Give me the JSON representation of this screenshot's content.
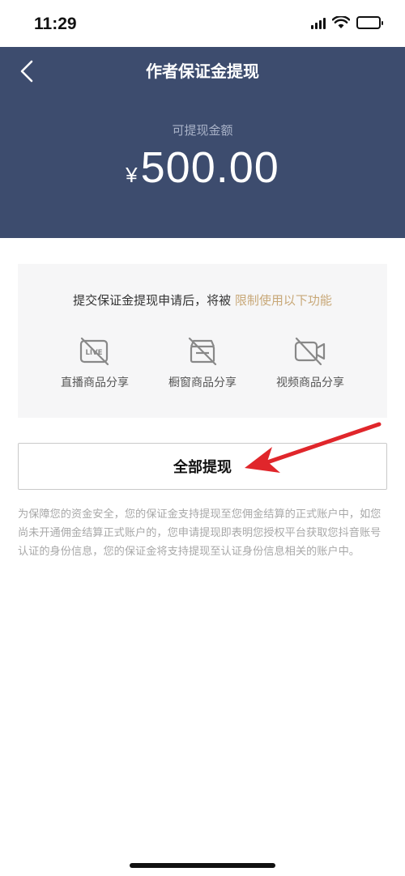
{
  "status_bar": {
    "time": "11:29"
  },
  "header": {
    "title": "作者保证金提现",
    "balance_label": "可提现金额",
    "currency_symbol": "¥",
    "amount": "500.00",
    "bg_color": "#3d4c6e"
  },
  "notice": {
    "text_prefix": "提交保证金提现申请后，将被 ",
    "text_highlight": "限制使用以下功能",
    "highlight_color": "#c8a878",
    "features": [
      {
        "icon": "live-disabled-icon",
        "label": "直播商品分享"
      },
      {
        "icon": "store-disabled-icon",
        "label": "橱窗商品分享"
      },
      {
        "icon": "video-disabled-icon",
        "label": "视频商品分享"
      }
    ]
  },
  "withdraw_button": {
    "label": "全部提现"
  },
  "disclaimer": "为保障您的资金安全，您的保证金支持提现至您佣金结算的正式账户中，如您尚未开通佣金结算正式账户的，您申请提现即表明您授权平台获取您抖音账号认证的身份信息，您的保证金将支持提现至认证身份信息相关的账户中。"
}
